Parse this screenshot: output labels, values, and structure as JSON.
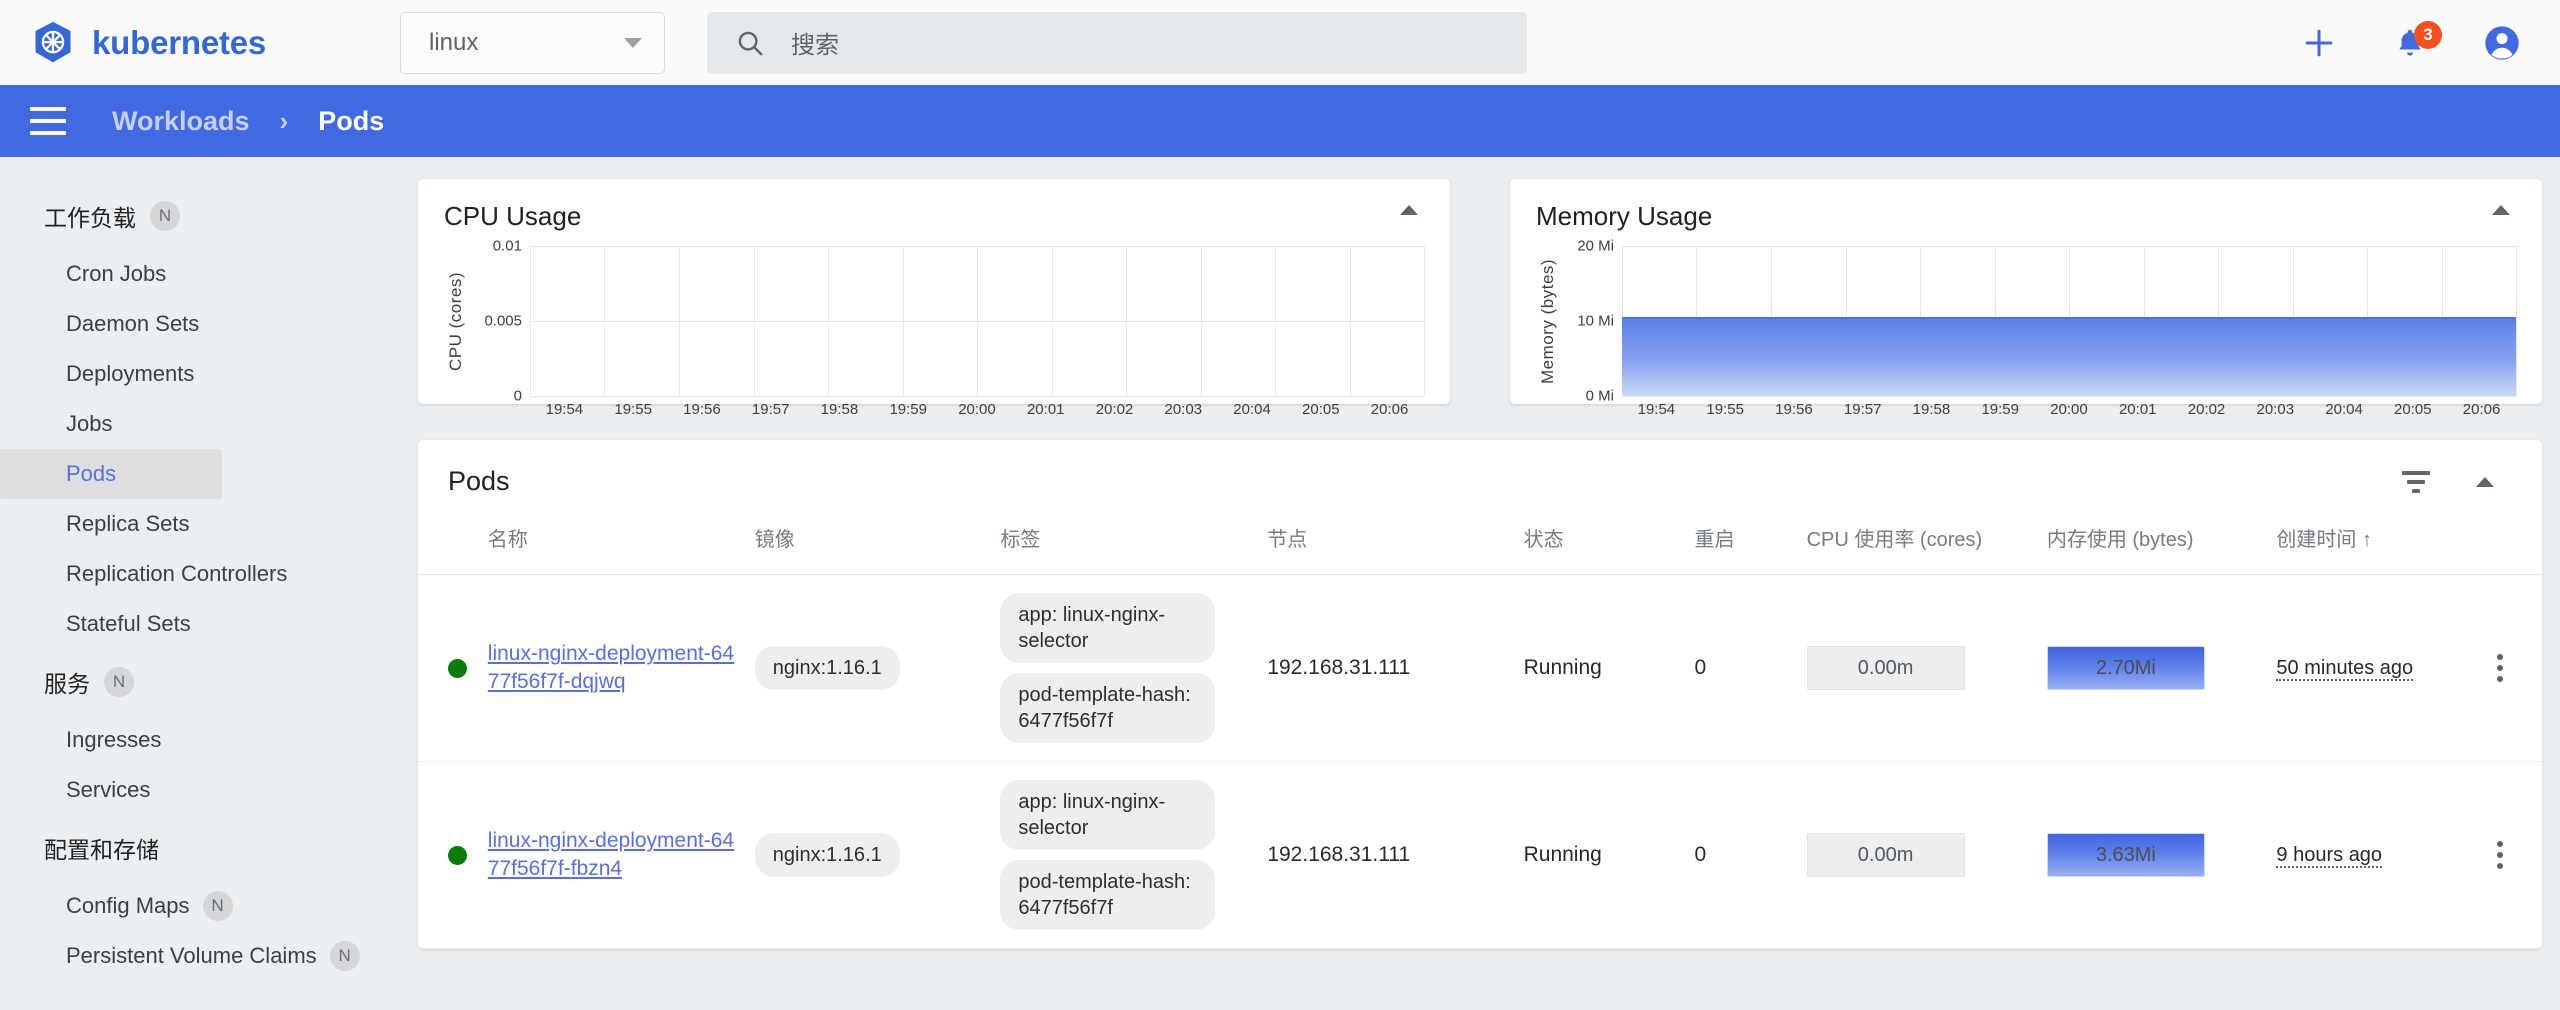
{
  "header": {
    "brand": "kubernetes",
    "logo_icon": "kubernetes-helm-wheel-icon",
    "namespace_value": "linux",
    "namespace_caret_icon": "chevron-down-icon",
    "search_icon": "search-icon",
    "search_placeholder": "搜索",
    "search_value": "",
    "create_icon": "plus-icon",
    "notifications_icon": "bell-icon",
    "notifications_count": "3",
    "account_icon": "account-circle-icon"
  },
  "breadcrumb": {
    "menu_icon": "hamburger-menu-icon",
    "parent": "Workloads",
    "separator": "›",
    "current": "Pods"
  },
  "sidebar": {
    "groups": [
      {
        "title": "工作负载",
        "badge": "N",
        "items": [
          {
            "label": "Cron Jobs",
            "badge": "",
            "active": false
          },
          {
            "label": "Daemon Sets",
            "badge": "",
            "active": false
          },
          {
            "label": "Deployments",
            "badge": "",
            "active": false
          },
          {
            "label": "Jobs",
            "badge": "",
            "active": false
          },
          {
            "label": "Pods",
            "badge": "",
            "active": true
          },
          {
            "label": "Replica Sets",
            "badge": "",
            "active": false
          },
          {
            "label": "Replication Controllers",
            "badge": "",
            "active": false
          },
          {
            "label": "Stateful Sets",
            "badge": "",
            "active": false
          }
        ]
      },
      {
        "title": "服务",
        "badge": "N",
        "items": [
          {
            "label": "Ingresses",
            "badge": "",
            "active": false
          },
          {
            "label": "Services",
            "badge": "",
            "active": false
          }
        ]
      },
      {
        "title": "配置和存储",
        "badge": "",
        "items": [
          {
            "label": "Config Maps",
            "badge": "N",
            "active": false
          },
          {
            "label": "Persistent Volume Claims",
            "badge": "N",
            "active": false
          }
        ]
      }
    ]
  },
  "chart_data": [
    {
      "type": "area",
      "title": "CPU Usage",
      "xlabel": "",
      "ylabel": "CPU (cores)",
      "x": [
        "19:54",
        "19:55",
        "19:56",
        "19:57",
        "19:58",
        "19:59",
        "20:00",
        "20:01",
        "20:02",
        "20:03",
        "20:04",
        "20:05",
        "20:06"
      ],
      "yticks": [
        "0.01",
        "0.005",
        "0"
      ],
      "ylim": [
        0,
        0.01
      ],
      "values": [
        0,
        0,
        0,
        0,
        0,
        0,
        0,
        0,
        0,
        0,
        0,
        0,
        0
      ],
      "grid": true,
      "legend": "none",
      "collapse_icon": "triangle-up-icon"
    },
    {
      "type": "area",
      "title": "Memory Usage",
      "xlabel": "",
      "ylabel": "Memory (bytes)",
      "x": [
        "19:54",
        "19:55",
        "19:56",
        "19:57",
        "19:58",
        "19:59",
        "20:00",
        "20:01",
        "20:02",
        "20:03",
        "20:04",
        "20:05",
        "20:06"
      ],
      "yticks": [
        "20 Mi",
        "10 Mi",
        "0 Mi"
      ],
      "ylim": [
        0,
        20
      ],
      "values": [
        10.6,
        10.6,
        10.6,
        10.6,
        10.6,
        10.6,
        10.6,
        10.6,
        10.6,
        10.6,
        10.6,
        10.6,
        10.6
      ],
      "grid": true,
      "legend": "none",
      "collapse_icon": "triangle-up-icon"
    }
  ],
  "pods_card": {
    "title": "Pods",
    "filter_icon": "filter-list-icon",
    "collapse_icon": "triangle-up-icon",
    "columns": [
      "名称",
      "镜像",
      "标签",
      "节点",
      "状态",
      "重启",
      "CPU 使用率 (cores)",
      "内存使用 (bytes)",
      "创建时间 ↑"
    ],
    "rows": [
      {
        "status_color": "#0a7c0a",
        "name": "linux-nginx-deployment-6477f56f7f-dqjwq",
        "image": "nginx:1.16.1",
        "labels": [
          "app: linux-nginx-selector",
          "pod-template-hash: 6477f56f7f"
        ],
        "node": "192.168.31.111",
        "status": "Running",
        "restarts": "0",
        "cpu": "0.00m",
        "memory": "2.70Mi",
        "created": "50 minutes ago",
        "menu_icon": "more-vert-icon"
      },
      {
        "status_color": "#0a7c0a",
        "name": "linux-nginx-deployment-6477f56f7f-fbzn4",
        "image": "nginx:1.16.1",
        "labels": [
          "app: linux-nginx-selector",
          "pod-template-hash: 6477f56f7f"
        ],
        "node": "192.168.31.111",
        "status": "Running",
        "restarts": "0",
        "cpu": "0.00m",
        "memory": "3.63Mi",
        "created": "9 hours ago",
        "menu_icon": "more-vert-icon"
      }
    ]
  }
}
